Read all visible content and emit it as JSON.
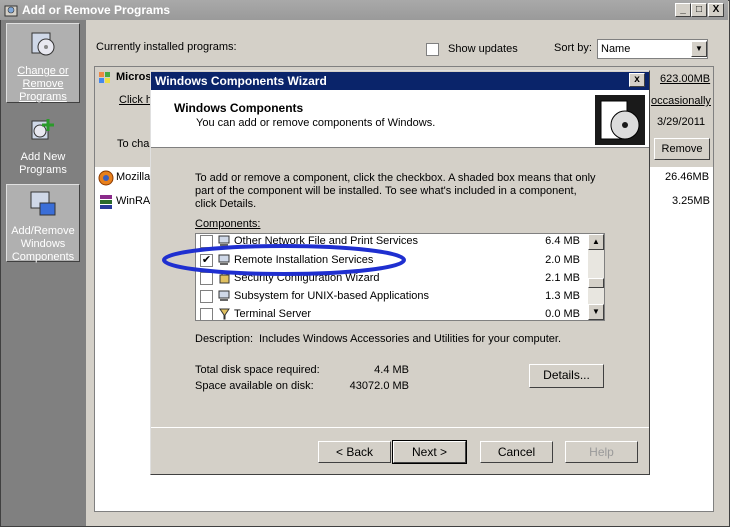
{
  "window": {
    "title": "Add or Remove Programs",
    "controls": {
      "minimize": "_",
      "maximize": "□",
      "close": "X"
    }
  },
  "nav": {
    "items": [
      {
        "label": "Change or Remove Programs",
        "icon": "change-programs-icon",
        "selected": true
      },
      {
        "label": "Add New Programs",
        "icon": "add-programs-icon",
        "selected": false
      },
      {
        "label": "Add/Remove Windows Components",
        "icon": "windows-components-icon",
        "selected": true
      }
    ]
  },
  "main": {
    "installed_label": "Currently installed programs:",
    "show_updates_label": "Show updates",
    "sort_by_label": "Sort by:",
    "sort_by_value": "Name",
    "programs": [
      {
        "name": "Micros",
        "size": "623.00MB",
        "used": "occasionally",
        "last_used": "3/29/2011",
        "click_text": "Click h",
        "change_text": "To cha",
        "remove_label": "Remove"
      },
      {
        "name": "Mozilla",
        "size": "26.46MB"
      },
      {
        "name": "WinRA",
        "size": "3.25MB"
      }
    ]
  },
  "wizard": {
    "title": "Windows Components Wizard",
    "close": "x",
    "heading": "Windows Components",
    "subheading": "You can add or remove components of Windows.",
    "instructions": "To add or remove a component, click the checkbox.  A shaded box means that only part of the component will be installed.  To see what's included in a component, click Details.",
    "components_label": "Components:",
    "components": [
      {
        "name": "Other Network File and Print Services",
        "size": "6.4 MB",
        "checked": false
      },
      {
        "name": "Remote Installation Services",
        "size": "2.0 MB",
        "checked": true
      },
      {
        "name": "Security Configuration Wizard",
        "size": "2.1 MB",
        "checked": false
      },
      {
        "name": "Subsystem for UNIX-based Applications",
        "size": "1.3 MB",
        "checked": false
      },
      {
        "name": "Terminal Server",
        "size": "0.0 MB",
        "checked": false
      }
    ],
    "description_label": "Description:",
    "description": "Includes Windows Accessories and Utilities for your computer.",
    "total_label": "Total disk space required:",
    "total_value": "4.4 MB",
    "available_label": "Space available on disk:",
    "available_value": "43072.0 MB",
    "details_label": "Details...",
    "back_label": "< Back",
    "next_label": "Next >",
    "cancel_label": "Cancel",
    "help_label": "Help"
  },
  "colors": {
    "highlight_ellipse": "#1f2fd0",
    "wizard_titlebar": "#0a246a",
    "outer_titlebar": "#a0a0a0"
  }
}
